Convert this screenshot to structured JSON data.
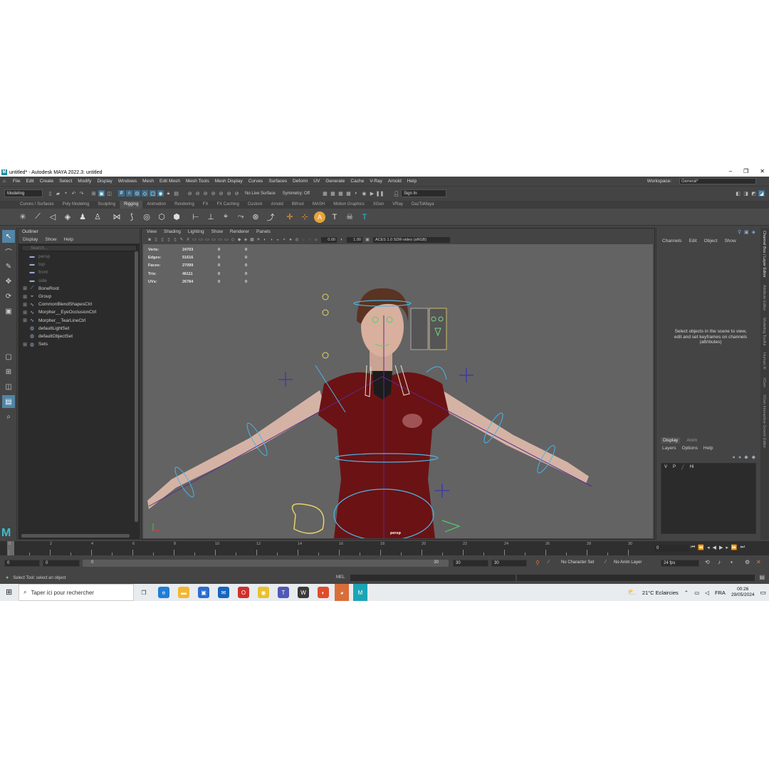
{
  "window": {
    "title": "untitled* - Autodesk MAYA 2022.3: untitled"
  },
  "menu": [
    "File",
    "Edit",
    "Create",
    "Select",
    "Modify",
    "Display",
    "Windows",
    "Mesh",
    "Edit Mesh",
    "Mesh Tools",
    "Mesh Display",
    "Curves",
    "Surfaces",
    "Deform",
    "UV",
    "Generate",
    "Cache",
    "V-Ray",
    "Arnold",
    "Help"
  ],
  "workspace": {
    "label": "Workspace:",
    "value": "General*"
  },
  "statusline": {
    "mode": "Modeling",
    "live_surface": "No Live Surface",
    "symmetry": "Symmetry: Off",
    "signin": "Sign In"
  },
  "shelf_tabs": [
    "Curves / Surfaces",
    "Poly Modeling",
    "Sculpting",
    "Rigging",
    "Animation",
    "Rendering",
    "FX",
    "FX Caching",
    "Custom",
    "Arnold",
    "Bifrost",
    "MASH",
    "Motion Graphics",
    "XGen",
    "VRay",
    "DazToMaya"
  ],
  "shelf_active": "Rigging",
  "outliner": {
    "title": "Outliner",
    "menu": [
      "Display",
      "Show",
      "Help"
    ],
    "search_placeholder": "Search...",
    "items": [
      {
        "label": "persp",
        "dim": true,
        "icon": "camera"
      },
      {
        "label": "top",
        "dim": true,
        "icon": "camera"
      },
      {
        "label": "front",
        "dim": true,
        "icon": "camera"
      },
      {
        "label": "side",
        "dim": true,
        "icon": "camera"
      },
      {
        "label": "BoneRoot",
        "expand": true,
        "icon": "joint"
      },
      {
        "label": "Group",
        "expand": true,
        "icon": "group"
      },
      {
        "label": "CommonBlendShapesCtrl",
        "expand": true,
        "icon": "curve"
      },
      {
        "label": "Morpher__EyeOcclusionCtrl",
        "expand": true,
        "icon": "curve"
      },
      {
        "label": "Morpher__TearLineCtrl",
        "expand": true,
        "icon": "curve"
      },
      {
        "label": "defaultLightSet",
        "icon": "set"
      },
      {
        "label": "defaultObjectSet",
        "icon": "set"
      },
      {
        "label": "Sets",
        "expand": true,
        "icon": "set"
      }
    ]
  },
  "viewport": {
    "menu": [
      "View",
      "Shading",
      "Lighting",
      "Show",
      "Renderer",
      "Panels"
    ],
    "exposure": "0.00",
    "gamma": "1.00",
    "colorspace": "ACES 1.0 SDR-video (sRGB)",
    "camera": "persp",
    "hud": [
      {
        "k": "Verts:",
        "v": "24703",
        "a": "0",
        "b": "0"
      },
      {
        "k": "Edges:",
        "v": "51616",
        "a": "0",
        "b": "0"
      },
      {
        "k": "Faces:",
        "v": "27099",
        "a": "0",
        "b": "0"
      },
      {
        "k": "Tris:",
        "v": "46111",
        "a": "0",
        "b": "0"
      },
      {
        "k": "UVs:",
        "v": "26784",
        "a": "0",
        "b": "0"
      }
    ]
  },
  "channelbox": {
    "menu": [
      "Channels",
      "Edit",
      "Object",
      "Show"
    ],
    "message": "Select objects in the scene to view, edit and set keyframes on channels (attributes)",
    "layer_tabs": [
      "Display",
      "Anim"
    ],
    "layer_menu": [
      "Layers",
      "Options",
      "Help"
    ],
    "layer": {
      "v": "V",
      "p": "P",
      "name": "Hi"
    }
  },
  "side_tabs": [
    "Channel Box / Layer Editor",
    "Attribute Editor",
    "Modeling Toolkit",
    "Human IK",
    "XGen",
    "XGen Interactive Groom Editor"
  ],
  "timeline": {
    "ticks": [
      "0",
      "2",
      "4",
      "6",
      "8",
      "10",
      "12",
      "14",
      "16",
      "18",
      "20",
      "22",
      "24",
      "26",
      "28",
      "30"
    ],
    "current": "0"
  },
  "range": {
    "start": "0",
    "inner_start": "0",
    "bar_start": "0",
    "bar_end": "30",
    "inner_end": "30",
    "end": "30",
    "char_set": "No Character Set",
    "anim_layer": "No Anim Layer",
    "fps": "24 fps"
  },
  "helpline": {
    "text": "Select Tool: select an object",
    "mel": "MEL"
  },
  "taskbar": {
    "search": "Taper ici pour rechercher",
    "weather": "21°C  Eclaircies",
    "lang": "FRA",
    "time": "00:26",
    "date": "29/05/2024"
  }
}
